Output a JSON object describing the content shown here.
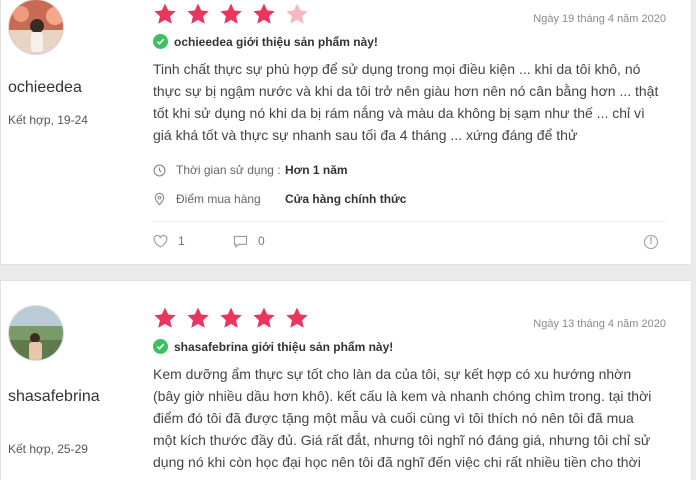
{
  "reviews": [
    {
      "username": "ochieedea",
      "combo": "Kết hợp, 19-24",
      "rating": 4,
      "max_rating": 5,
      "date": "Ngày 19 tháng 4 năm 2020",
      "recommend": "ochieedea giới thiệu sản phẩm này!",
      "lines": [
        "Tinh chất thực sự phù hợp để sử dụng trong mọi điều kiện ... khi da tôi khô, nó",
        "thực sự bị ngậm nước và khi da tôi trở nên giàu hơn nên nó cân bằng hơn ... thật",
        "tốt khi sử dụng nó khi da bị rám nắng và màu da không bị sạm như thế ... chỉ vì",
        "giá khá tốt và thực sự nhanh sau tối đa 4 tháng ... xứng đáng để thử"
      ],
      "usage_label": "Thời gian sử dụng :",
      "usage_value": "Hơn 1 năm",
      "purchase_label": "Điểm mua hàng",
      "purchase_value": "Cửa hàng chính thức",
      "likes": "1",
      "comments": "0"
    },
    {
      "username": "shasafebrina",
      "combo": "Kết hợp, 25-29",
      "rating": 5,
      "max_rating": 5,
      "date": "Ngày 13 tháng 4 năm 2020",
      "recommend": "shasafebrina giới thiệu sản phẩm này!",
      "lines": [
        "Kem dưỡng ẩm thực sự tốt cho làn da của tôi, sự kết hợp có xu hướng nhờn",
        "(bây giờ nhiều dầu hơn khô). kết cấu là kem và nhanh chóng chìm trong. tại thời",
        "điểm đó tôi đã được tặng một mẫu và cuối cùng vì tôi thích nó nên tôi đã mua",
        "một kích thước đầy đủ. Giá rất đắt, nhưng tôi nghĩ nó đáng giá, nhưng tôi chỉ sử",
        "dụng nó khi còn học đại học nên tôi đã nghĩ đến việc chi rất nhiều tiền cho thời"
      ]
    }
  ],
  "colors": {
    "star_filled": "#e8365d",
    "star_empty": "#f7b6c4",
    "check": "#3fbf61"
  },
  "icons": [
    "clock-icon",
    "location-pin-icon",
    "heart-icon",
    "comment-icon",
    "report-icon",
    "check-icon",
    "star-icon"
  ]
}
